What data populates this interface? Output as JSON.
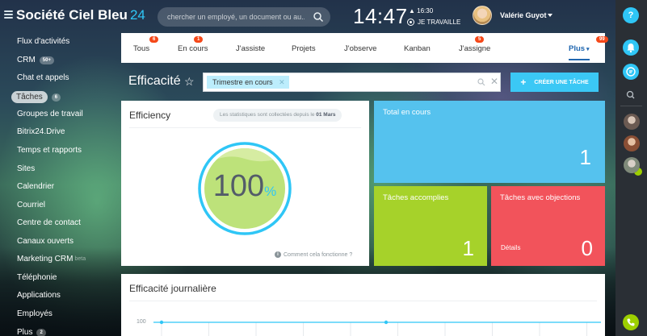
{
  "company": {
    "name": "Société Ciel Bleu",
    "number": "24"
  },
  "search": {
    "placeholder": "chercher un employé, un document ou au..."
  },
  "clock": {
    "time": "14:47",
    "alarm": "16:30",
    "status": "JE TRAVAILLE"
  },
  "user": {
    "name": "Valérie Guyot"
  },
  "left_menu": [
    {
      "label": "Flux d'activités"
    },
    {
      "label": "CRM",
      "badge": "50+"
    },
    {
      "label": "Chat et appels"
    },
    {
      "label": "Tâches",
      "badge": "6",
      "active": true
    },
    {
      "label": "Groupes de travail"
    },
    {
      "label": "Bitrix24.Drive"
    },
    {
      "label": "Temps et rapports"
    },
    {
      "label": "Sites"
    },
    {
      "label": "Calendrier"
    },
    {
      "label": "Courriel"
    },
    {
      "label": "Centre de contact"
    },
    {
      "label": "Canaux ouverts"
    },
    {
      "label": "Marketing CRM",
      "beta": "beta"
    },
    {
      "label": "Téléphonie"
    },
    {
      "label": "Applications"
    },
    {
      "label": "Employés"
    },
    {
      "label": "Plus",
      "badge": "2"
    }
  ],
  "tabs": [
    {
      "label": "Tous",
      "badge": "6"
    },
    {
      "label": "En cours",
      "badge": "1"
    },
    {
      "label": "J'assiste"
    },
    {
      "label": "Projets"
    },
    {
      "label": "J'observe"
    },
    {
      "label": "Kanban"
    },
    {
      "label": "J'assigne",
      "badge": "5"
    },
    {
      "label": "Plus",
      "badge": "99"
    }
  ],
  "page": {
    "title": "Efficacité"
  },
  "filter": {
    "chip": "Trimestre en cours"
  },
  "create_button": {
    "label": "CRÉER UNE TÂCHE"
  },
  "efficiency": {
    "title": "Efficiency",
    "note_prefix": "Les statistiques sont collectées depuis le",
    "note_date": "01 Mars",
    "value": "100",
    "unit": "%",
    "fill_fraction": 1.0,
    "help": "Comment cela fonctionne ?"
  },
  "tiles": {
    "total": {
      "title": "Total en cours",
      "value": "1",
      "color": "#55c2ee"
    },
    "done": {
      "title": "Tâches accomplies",
      "value": "1",
      "color": "#a6d22a"
    },
    "objections": {
      "title": "Tâches avec objections",
      "value": "0",
      "details": "Détails",
      "color": "#f2535b"
    }
  },
  "daily": {
    "title": "Efficacité journalière",
    "y_tick": "100"
  },
  "colors": {
    "accent": "#2fc6f6",
    "badge": "#f54819"
  }
}
